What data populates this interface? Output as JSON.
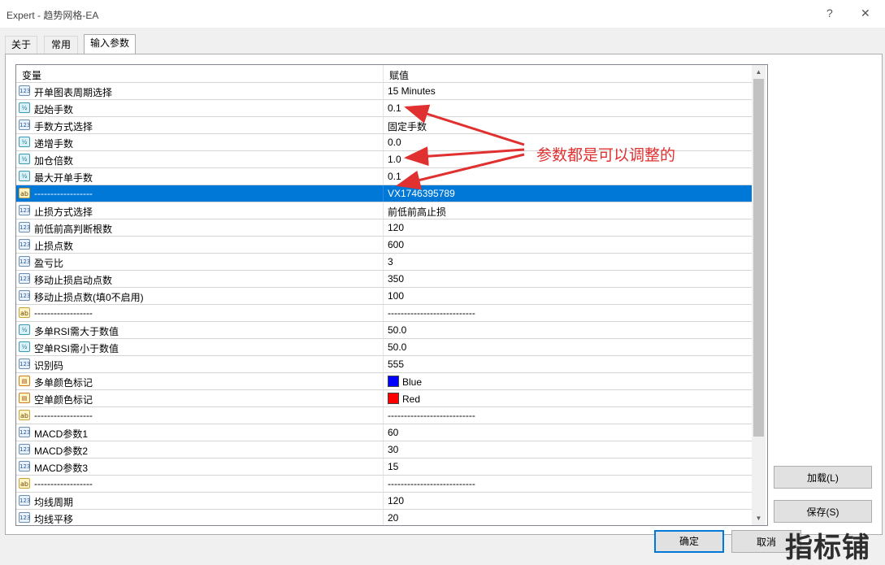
{
  "window": {
    "title": "Expert - 趋势网格-EA",
    "help_label": "?",
    "close_label": "✕"
  },
  "tabs": [
    {
      "label": "关于"
    },
    {
      "label": "常用"
    },
    {
      "label": "输入参数"
    }
  ],
  "active_tab": "输入参数",
  "table": {
    "headers": {
      "variable": "变量",
      "value": "赋值"
    },
    "rows": [
      {
        "icon": "int-icon",
        "name": "开单图表周期选择",
        "value": "15 Minutes"
      },
      {
        "icon": "double-icon",
        "name": "起始手数",
        "value": "0.1"
      },
      {
        "icon": "int-icon",
        "name": "手数方式选择",
        "value": "固定手数"
      },
      {
        "icon": "double-icon",
        "name": "递增手数",
        "value": "0.0"
      },
      {
        "icon": "double-icon",
        "name": "加仓倍数",
        "value": "1.0"
      },
      {
        "icon": "double-icon",
        "name": "最大开单手数",
        "value": "0.1"
      },
      {
        "icon": "string-icon",
        "name": "------------------",
        "value": "VX1746395789",
        "selected": true
      },
      {
        "icon": "int-icon",
        "name": "止损方式选择",
        "value": "前低前高止损"
      },
      {
        "icon": "int-icon",
        "name": "前低前高判断根数",
        "value": "120"
      },
      {
        "icon": "int-icon",
        "name": "止损点数",
        "value": "600"
      },
      {
        "icon": "int-icon",
        "name": "盈亏比",
        "value": "3"
      },
      {
        "icon": "int-icon",
        "name": "移动止损启动点数",
        "value": "350"
      },
      {
        "icon": "int-icon",
        "name": "移动止损点数(填0不启用)",
        "value": "100"
      },
      {
        "icon": "string-icon",
        "name": "------------------",
        "value": "---------------------------"
      },
      {
        "icon": "double-icon",
        "name": "多单RSI需大于数值",
        "value": "50.0"
      },
      {
        "icon": "double-icon",
        "name": "空单RSI需小于数值",
        "value": "50.0"
      },
      {
        "icon": "int-icon",
        "name": "识别码",
        "value": "555"
      },
      {
        "icon": "color-icon",
        "name": "多单颜色标记",
        "value": "Blue",
        "color": "#0000ff"
      },
      {
        "icon": "color-icon",
        "name": "空单颜色标记",
        "value": "Red",
        "color": "#ff0000"
      },
      {
        "icon": "string-icon",
        "name": "------------------",
        "value": "---------------------------"
      },
      {
        "icon": "int-icon",
        "name": "MACD参数1",
        "value": "60"
      },
      {
        "icon": "int-icon",
        "name": "MACD参数2",
        "value": "30"
      },
      {
        "icon": "int-icon",
        "name": "MACD参数3",
        "value": "15"
      },
      {
        "icon": "string-icon",
        "name": "------------------",
        "value": "---------------------------"
      },
      {
        "icon": "int-icon",
        "name": "均线周期",
        "value": "120"
      },
      {
        "icon": "int-icon",
        "name": "均线平移",
        "value": "20"
      }
    ]
  },
  "icon_glyphs": {
    "int-icon": "123",
    "double-icon": "½",
    "string-icon": "ab",
    "color-icon": "▤"
  },
  "buttons": {
    "load": "加载(L)",
    "save": "保存(S)",
    "ok": "确定",
    "cancel": "取消"
  },
  "annotation": {
    "text": "参数都是可以调整的",
    "color": "#e03030"
  },
  "watermark": "指标铺",
  "colors": {
    "selection": "#0078d7",
    "default_button_border": "#0078d7"
  }
}
